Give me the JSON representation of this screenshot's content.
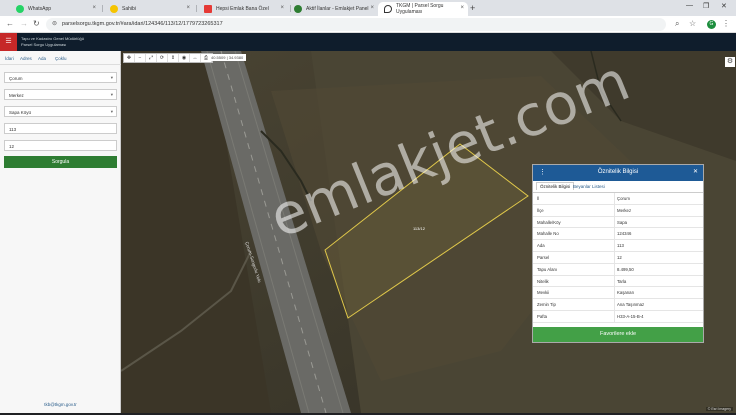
{
  "browser": {
    "tabs": [
      {
        "label": "WhatsApp",
        "color": "#25d366"
      },
      {
        "label": "Sahibi",
        "color": "#f5c400"
      },
      {
        "label": "Hepsi Emlak Bana Özel",
        "color": "#e53935"
      },
      {
        "label": "Aktif İlanlar - Emlakjet Panel",
        "color": "#2e7d32"
      },
      {
        "label": "TKGM | Parsel Sorgu Uygulaması",
        "color": "#1e88e5"
      }
    ],
    "url": "parselsorgu.tkgm.gov.tr/#ara/idari/124346/113/12/1779723265317",
    "profile_initial": "G"
  },
  "app": {
    "title_line1": "Tapu ve Kadastro Genel Müdürlüğü",
    "title_line2": "Parsel Sorgu Uygulaması"
  },
  "left_panel": {
    "tabs": [
      "İdari",
      "Adres",
      "Ada",
      "Çoklu"
    ],
    "fields": [
      {
        "value": "Çorum",
        "has_dropdown": true
      },
      {
        "value": "Merkez",
        "has_dropdown": true
      },
      {
        "value": "Sapa Köyü",
        "has_dropdown": true
      },
      {
        "value": "113",
        "has_dropdown": false
      },
      {
        "value": "12",
        "has_dropdown": false
      }
    ],
    "submit_label": "Sorgula",
    "contact_email": "tkb@tkgm.gov.tr"
  },
  "map": {
    "toolbar_icons": [
      "pan-icon",
      "zoom-out-icon",
      "zoom-extent-icon",
      "rotate-icon",
      "move-icon",
      "locate-icon",
      "measure-icon",
      "print-icon"
    ],
    "coordinate_readout": "40.5509 | 34.9380",
    "parcel_label": "113/12",
    "road_label": "Çorum-Sungurlu Yolu",
    "watermark": "emlakjet.com",
    "attribution": "© Esri Imagery"
  },
  "attributes_panel": {
    "title": "Öznitelik Bilgisi",
    "tabs": [
      "Öznitelik Bilgisi",
      "Beyanlar Listesi"
    ],
    "rows": [
      {
        "key": "İl",
        "value": "Çorum"
      },
      {
        "key": "İlçe",
        "value": "Merkez"
      },
      {
        "key": "Mahalle/Köy",
        "value": "Sapa"
      },
      {
        "key": "Mahalle No",
        "value": "124346"
      },
      {
        "key": "Ada",
        "value": "113"
      },
      {
        "key": "Parsel",
        "value": "12"
      },
      {
        "key": "Tapu Alanı",
        "value": "8.499,50"
      },
      {
        "key": "Nitelik",
        "value": "Tarla"
      },
      {
        "key": "Mevkii",
        "value": "Kaşanan"
      },
      {
        "key": "Zemin Tip",
        "value": "Ana Taşınmaz"
      },
      {
        "key": "Pafta",
        "value": "H33-A-15-B-4"
      }
    ],
    "favorite_label": "Favorilere ekle"
  }
}
